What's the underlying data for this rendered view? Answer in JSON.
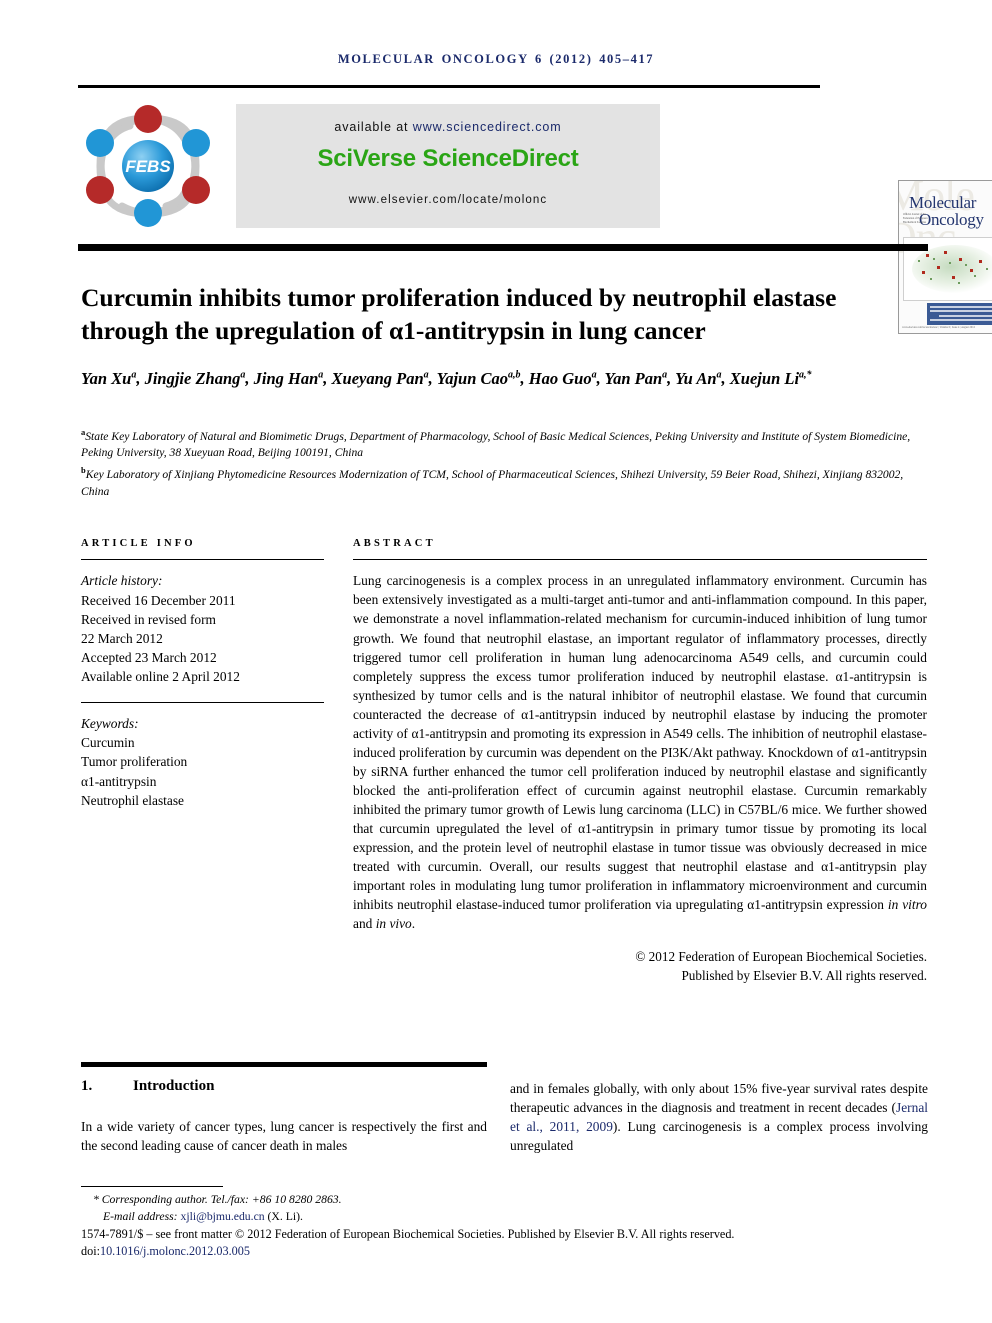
{
  "running_head": "MOLECULAR ONCOLOGY 6 (2012) 405–417",
  "masthead": {
    "logo_text": "FEBS",
    "available_prefix": "available at ",
    "available_url": "www.sciencedirect.com",
    "platform": "SciVerse ScienceDirect",
    "locate_url": "www.elsevier.com/locate/molonc",
    "cover": {
      "title_line1": "Molecular",
      "title_line2": "Oncology",
      "sub_text": "Official Journal of the Federation of European Biochemical Societies",
      "footer_text": "www.elsevier.com/locate/molonc | Volume 6 | Issue 4 | August 2012"
    }
  },
  "title": "Curcumin inhibits tumor proliferation induced by neutrophil elastase through the upregulation of α1-antitrypsin in lung cancer",
  "authors_line1": "Yan Xu",
  "authors": [
    {
      "name": "Yan Xu",
      "sup": "a"
    },
    {
      "name": "Jingjie Zhang",
      "sup": "a"
    },
    {
      "name": "Jing Han",
      "sup": "a"
    },
    {
      "name": "Xueyang Pan",
      "sup": "a"
    },
    {
      "name": "Yajun Cao",
      "sup": "a,b"
    },
    {
      "name": "Hao Guo",
      "sup": "a"
    },
    {
      "name": "Yan Pan",
      "sup": "a"
    },
    {
      "name": "Yu An",
      "sup": "a"
    },
    {
      "name": "Xuejun Li",
      "sup": "a,*"
    }
  ],
  "affiliations": [
    {
      "marker": "a",
      "text": "State Key Laboratory of Natural and Biomimetic Drugs, Department of Pharmacology, School of Basic Medical Sciences, Peking University and Institute of System Biomedicine, Peking University, 38 Xueyuan Road, Beijing 100191, China"
    },
    {
      "marker": "b",
      "text": "Key Laboratory of Xinjiang Phytomedicine Resources Modernization of TCM, School of Pharmaceutical Sciences, Shihezi University, 59 Beier Road, Shihezi, Xinjiang 832002, China"
    }
  ],
  "article_info": {
    "label": "ARTICLE INFO",
    "history_label": "Article history:",
    "history": [
      "Received 16 December 2011",
      "Received in revised form",
      "22 March 2012",
      "Accepted 23 March 2012",
      "Available online 2 April 2012"
    ],
    "keywords_label": "Keywords:",
    "keywords": [
      "Curcumin",
      "Tumor proliferation",
      "α1-antitrypsin",
      "Neutrophil elastase"
    ]
  },
  "abstract": {
    "label": "ABSTRACT",
    "part1": "Lung carcinogenesis is a complex process in an unregulated inflammatory environment. Curcumin has been extensively investigated as a multi-target anti-tumor and anti-inflammation compound. In this paper, we demonstrate a novel inflammation-related mechanism for curcumin-induced inhibition of lung tumor growth. We found that neutrophil elastase, an important regulator of inflammatory processes, directly triggered tumor cell proliferation in human lung adenocarcinoma A549 cells, and curcumin could completely suppress the excess tumor proliferation induced by neutrophil elastase. α1-antitrypsin is synthesized by tumor cells and is the natural inhibitor of neutrophil elastase. We found that curcumin counteracted the decrease of α1-antitrypsin induced by neutrophil elastase by inducing the promoter activity of α1-antitrypsin and promoting its expression in A549 cells. The inhibition of neutrophil elastase-induced proliferation by curcumin was dependent on the PI3K/Akt pathway. Knockdown of α1-antitrypsin by siRNA further enhanced the tumor cell proliferation induced by neutrophil elastase and significantly blocked the anti-proliferation effect of curcumin against neutrophil elastase. Curcumin remarkably inhibited the primary tumor growth of Lewis lung carcinoma (LLC) in C57BL/6 mice. We further showed that curcumin upregulated the level of α1-antitrypsin in primary tumor tissue by promoting its local expression, and the protein level of neutrophil elastase in tumor tissue was obviously decreased in mice treated with curcumin. Overall, our results suggest that neutrophil elastase and α1-antitrypsin play important roles in modulating lung tumor proliferation in inflammatory microenvironment and curcumin inhibits neutrophil elastase-induced tumor proliferation via upregulating α1-antitrypsin expression ",
    "part_italic": "in vitro",
    "part2": " and ",
    "part_italic2": "in vivo",
    "part3": ".",
    "copyright_line1": "© 2012 Federation of European Biochemical Societies.",
    "copyright_line2": "Published by Elsevier B.V. All rights reserved."
  },
  "introduction": {
    "number": "1.",
    "heading": "Introduction",
    "left_text": "In a wide variety of cancer types, lung cancer is respectively the first and the second leading cause of cancer death in males",
    "right_pre": "and in females globally, with only about 15% five-year survival rates despite therapeutic advances in the diagnosis and treatment in recent decades (",
    "right_citation": "Jernal et al., 2011, 2009",
    "right_post": "). Lung carcinogenesis is a complex process involving unregulated"
  },
  "footer": {
    "corresponding": "* Corresponding author. Tel./fax: +86 10 8280 2863.",
    "email_label": "E-mail address: ",
    "email": "xjli@bjmu.edu.cn",
    "email_suffix": " (X. Li).",
    "issn_line": "1574-7891/$ – see front matter © 2012 Federation of European Biochemical Societies. Published by Elsevier B.V. All rights reserved.",
    "doi_label": "doi:",
    "doi": "10.1016/j.molonc.2012.03.005"
  },
  "colors": {
    "running_head": "#1b2a6b",
    "sciencedirect_green": "#2aa515",
    "link_blue": "#1b2a6b",
    "banner_gray": "#e3e3e3"
  }
}
